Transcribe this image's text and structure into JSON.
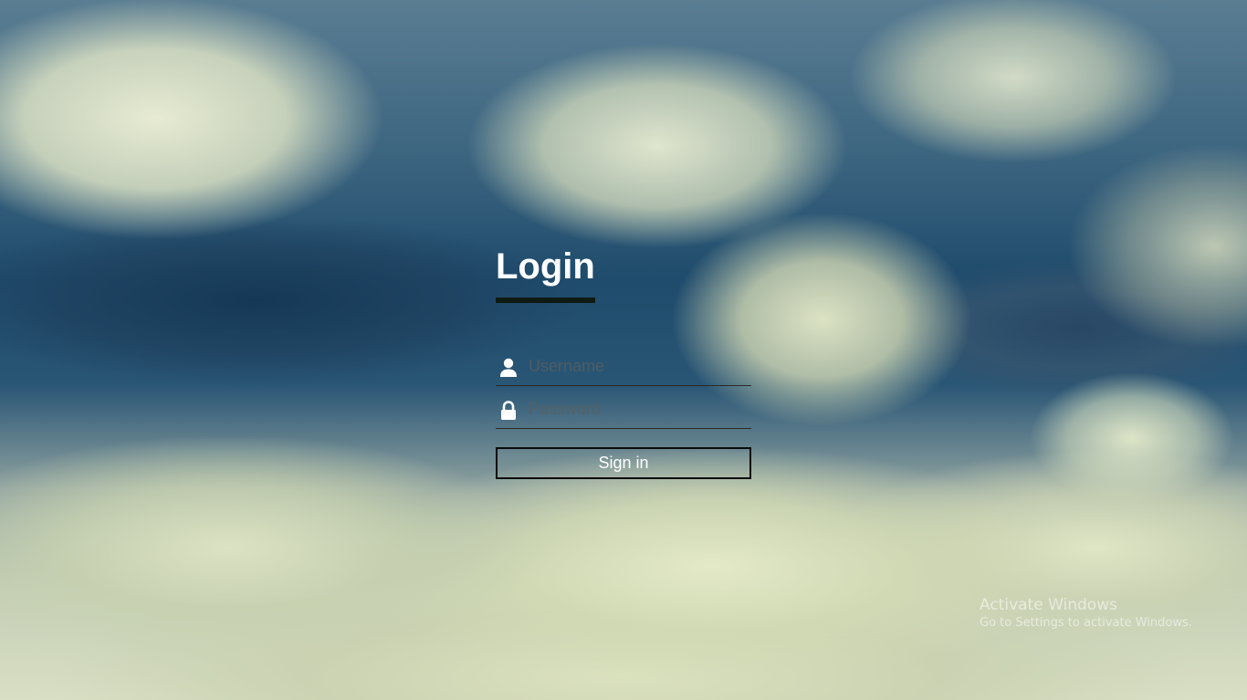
{
  "login": {
    "title": "Login",
    "username": {
      "placeholder": "Username",
      "value": "",
      "icon": "user-icon"
    },
    "password": {
      "placeholder": "Password",
      "value": "",
      "icon": "lock-icon"
    },
    "signin_label": "Sign in"
  },
  "watermark": {
    "title": "Activate Windows",
    "subtitle": "Go to Settings to activate Windows."
  },
  "colors": {
    "title_text": "#ffffff",
    "underline": "#0f1a12",
    "button_border": "#0b0b0b",
    "field_border": "#2a2a2a"
  }
}
